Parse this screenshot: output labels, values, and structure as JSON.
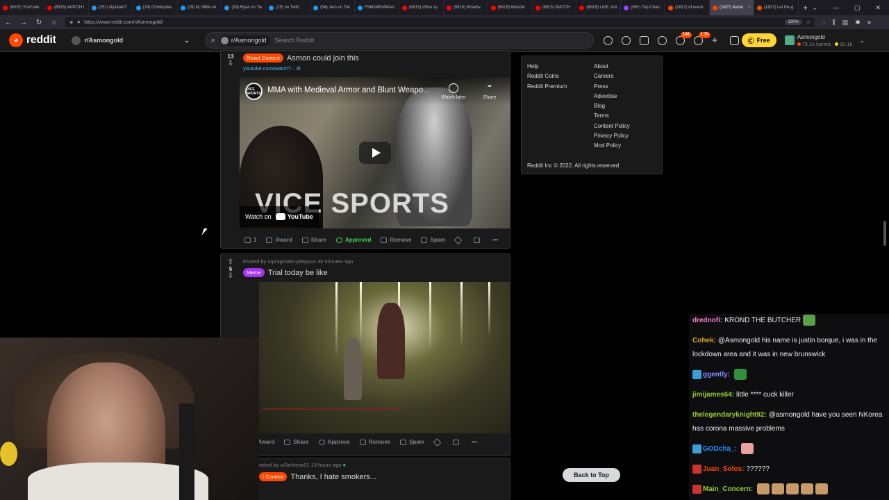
{
  "browser": {
    "tabs": [
      {
        "label": "(6915) YouTube",
        "color": "#ff0000"
      },
      {
        "label": "(6915) WATCH I",
        "color": "#ff0000"
      },
      {
        "label": "(25) LillyJaneIT",
        "color": "#1d9bf0"
      },
      {
        "label": "(29) Christophe",
        "color": "#1d9bf0"
      },
      {
        "label": "(29) M, MBA on",
        "color": "#1d9bf0"
      },
      {
        "label": "(29) Ryan on Tw",
        "color": "#1d9bf0"
      },
      {
        "label": "(25) on Twitt",
        "color": "#1d9bf0"
      },
      {
        "label": "(54) Jem on Twi",
        "color": "#1d9bf0"
      },
      {
        "label": "FS6O4BmWAAt",
        "color": "#1d9bf0"
      },
      {
        "label": "(6915) office sp",
        "color": "#ff0000"
      },
      {
        "label": "(6915) Woodw",
        "color": "#ff0000"
      },
      {
        "label": "(6915) Woodw",
        "color": "#ff0000"
      },
      {
        "label": "(6915) WATCH",
        "color": "#ff0000"
      },
      {
        "label": "(6915) LIVE: Am",
        "color": "#ff0000"
      },
      {
        "label": "(99+) Top Chan",
        "color": "#9147ff"
      },
      {
        "label": "(1827) r/Livestr",
        "color": "#ff4500"
      },
      {
        "label": "(1827) Asmo",
        "color": "#ff4500",
        "active": true
      },
      {
        "label": "(1827) Let the g",
        "color": "#ff4500"
      }
    ],
    "url": "https://www.reddit.com/r/Asmongold/",
    "zoom": "130%"
  },
  "header": {
    "logo": "reddit",
    "community": "r/Asmongold",
    "search_pill": "r/Asmongold",
    "search_placeholder": "Search Reddit",
    "badge_chat": "148",
    "badge_notif": "1.7k",
    "free_label": "Free",
    "username": "Asmongold",
    "karma": "75.1k karma",
    "coins": "10.1k"
  },
  "post1": {
    "votes": "13",
    "flair": "React Content",
    "flair_color": "#ff4500",
    "title": "Asmon could join this",
    "link": "youtube.com/watch?...",
    "video_channel": "VICE SPORTS",
    "video_title": "MMA with Medieval Armor and Blunt Weapo...",
    "watch_later": "Watch later",
    "share_label": "Share",
    "watch_on": "Watch on",
    "youtube": "YouTube",
    "overlay_text": "VICE SPORTS",
    "comments": "1",
    "actions": {
      "award": "Award",
      "share": "Share",
      "approved": "Approved",
      "remove": "Remove",
      "spam": "Spam"
    }
  },
  "post2": {
    "meta": "Posted by u/pragmatic-platypus 40 minutes ago",
    "votes": "5",
    "flair": "Meme",
    "flair_color": "#a335ee",
    "title": "Trial today be like",
    "actions": {
      "award": "Award",
      "share": "Share",
      "approve": "Approve",
      "remove": "Remove",
      "spam": "Spam"
    }
  },
  "post3": {
    "meta": "osted by u/Archeus01 13 hours ago",
    "flair": "t Content",
    "flair_color": "#ff4500",
    "title": "Thanks, I hate smokers..."
  },
  "sidebar": {
    "left": [
      "Help",
      "Reddit Coins",
      "Reddit Premium"
    ],
    "right": [
      "About",
      "Careers",
      "Press",
      "Advertise",
      "Blog",
      "Terms",
      "Content Policy",
      "Privacy Policy",
      "Mod Policy"
    ],
    "copyright": "Reddit Inc © 2022. All rights reserved"
  },
  "back_to_top": "Back to Top",
  "chat": [
    {
      "user": "drednofi:",
      "color": "#ff7fd0",
      "text": "KROND THE BUTCHER"
    },
    {
      "user": "Cohek:",
      "color": "#daa520",
      "text": "@Asmongold his name is justin borque, i was in the lockdown area and it was in new brunswick"
    },
    {
      "user": "ggently:",
      "color": "#8a8aff",
      "text": ""
    },
    {
      "user": "jimijames64:",
      "color": "#9acd32",
      "text": "little **** cuck killer"
    },
    {
      "user": "thelegendaryknight92:",
      "color": "#9acd32",
      "text": "@asmongold have you seen NKorea has corona massive problems"
    },
    {
      "user": "GODcha_:",
      "color": "#1e90ff",
      "text": ""
    },
    {
      "user": "Juan_Solos:",
      "color": "#ff4500",
      "text": "??????"
    },
    {
      "user": "Main_Concern:",
      "color": "#9acd32",
      "text": ""
    }
  ]
}
